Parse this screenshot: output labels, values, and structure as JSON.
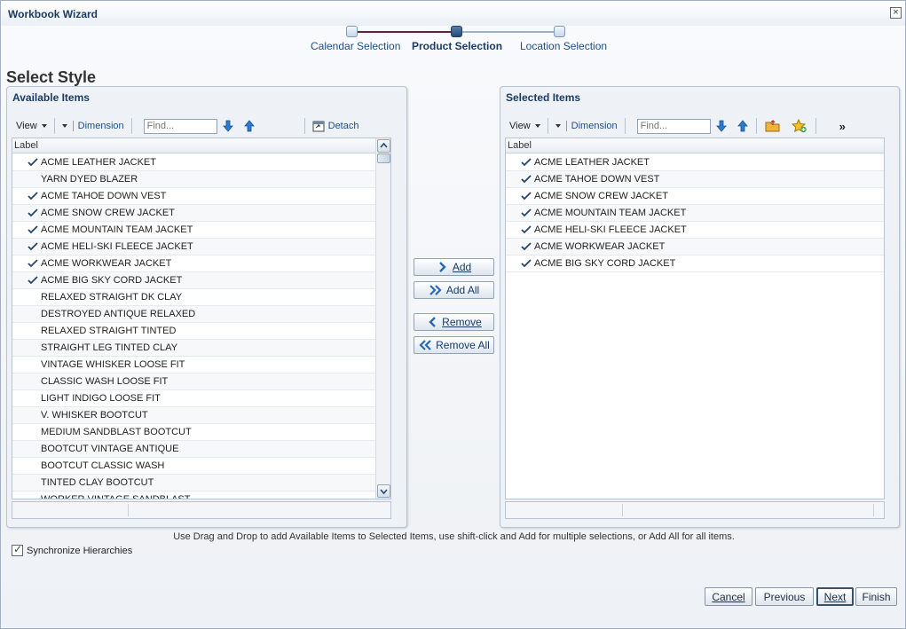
{
  "window": {
    "title": "Workbook Wizard",
    "close_icon": "close-icon"
  },
  "train": {
    "steps": [
      {
        "label": "Calendar Selection",
        "state": "visited"
      },
      {
        "label": "Product Selection",
        "state": "current"
      },
      {
        "label": "Location Selection",
        "state": "unvisited"
      }
    ]
  },
  "page_title": "Select Style",
  "available": {
    "header": "Available Items",
    "toolbar": {
      "view_label": "View",
      "dimension_label": "Dimension",
      "find_placeholder": "Find...",
      "detach_label": "Detach"
    },
    "column_header": "Label",
    "rows": [
      {
        "label": "ACME LEATHER JACKET",
        "checked": true
      },
      {
        "label": "YARN DYED BLAZER",
        "checked": false
      },
      {
        "label": "ACME TAHOE DOWN VEST",
        "checked": true
      },
      {
        "label": "ACME SNOW CREW JACKET",
        "checked": true
      },
      {
        "label": "ACME MOUNTAIN TEAM JACKET",
        "checked": true
      },
      {
        "label": "ACME HELI-SKI FLEECE JACKET",
        "checked": true
      },
      {
        "label": "ACME WORKWEAR JACKET",
        "checked": true
      },
      {
        "label": "ACME BIG SKY CORD JACKET",
        "checked": true
      },
      {
        "label": "RELAXED STRAIGHT DK CLAY",
        "checked": false
      },
      {
        "label": "DESTROYED ANTIQUE RELAXED",
        "checked": false
      },
      {
        "label": "RELAXED STRAIGHT TINTED",
        "checked": false
      },
      {
        "label": "STRAIGHT LEG TINTED CLAY",
        "checked": false
      },
      {
        "label": "VINTAGE WHISKER LOOSE FIT",
        "checked": false
      },
      {
        "label": "CLASSIC WASH LOOSE FIT",
        "checked": false
      },
      {
        "label": "LIGHT INDIGO LOOSE FIT",
        "checked": false
      },
      {
        "label": "V. WHISKER BOOTCUT",
        "checked": false
      },
      {
        "label": "MEDIUM SANDBLAST BOOTCUT",
        "checked": false
      },
      {
        "label": "BOOTCUT VINTAGE ANTIQUE",
        "checked": false
      },
      {
        "label": "BOOTCUT CLASSIC WASH",
        "checked": false
      },
      {
        "label": "TINTED CLAY BOOTCUT",
        "checked": false
      },
      {
        "label": "WORKER VINTAGE SANDBLAST",
        "checked": false
      }
    ]
  },
  "selected": {
    "header": "Selected Items",
    "toolbar": {
      "view_label": "View",
      "dimension_label": "Dimension",
      "find_placeholder": "Find...",
      "more_label": "»"
    },
    "column_header": "Label",
    "rows": [
      {
        "label": "ACME LEATHER JACKET",
        "checked": true
      },
      {
        "label": "ACME TAHOE DOWN VEST",
        "checked": true
      },
      {
        "label": "ACME SNOW CREW JACKET",
        "checked": true
      },
      {
        "label": "ACME MOUNTAIN TEAM JACKET",
        "checked": true
      },
      {
        "label": "ACME HELI-SKI FLEECE JACKET",
        "checked": true
      },
      {
        "label": "ACME WORKWEAR JACKET",
        "checked": true
      },
      {
        "label": "ACME BIG SKY CORD JACKET",
        "checked": true
      }
    ]
  },
  "shuttle": {
    "add": "Add",
    "add_all": "Add All",
    "remove": "Remove",
    "remove_all": "Remove All"
  },
  "help_text": "Use Drag and Drop to add Available Items to Selected Items, use shift-click and Add for multiple selections, or Add All for all items.",
  "sync_label": "Synchronize Hierarchies",
  "sync_checked": true,
  "buttons": {
    "cancel": "Cancel",
    "previous": "Previous",
    "next": "Next",
    "finish": "Finish"
  }
}
